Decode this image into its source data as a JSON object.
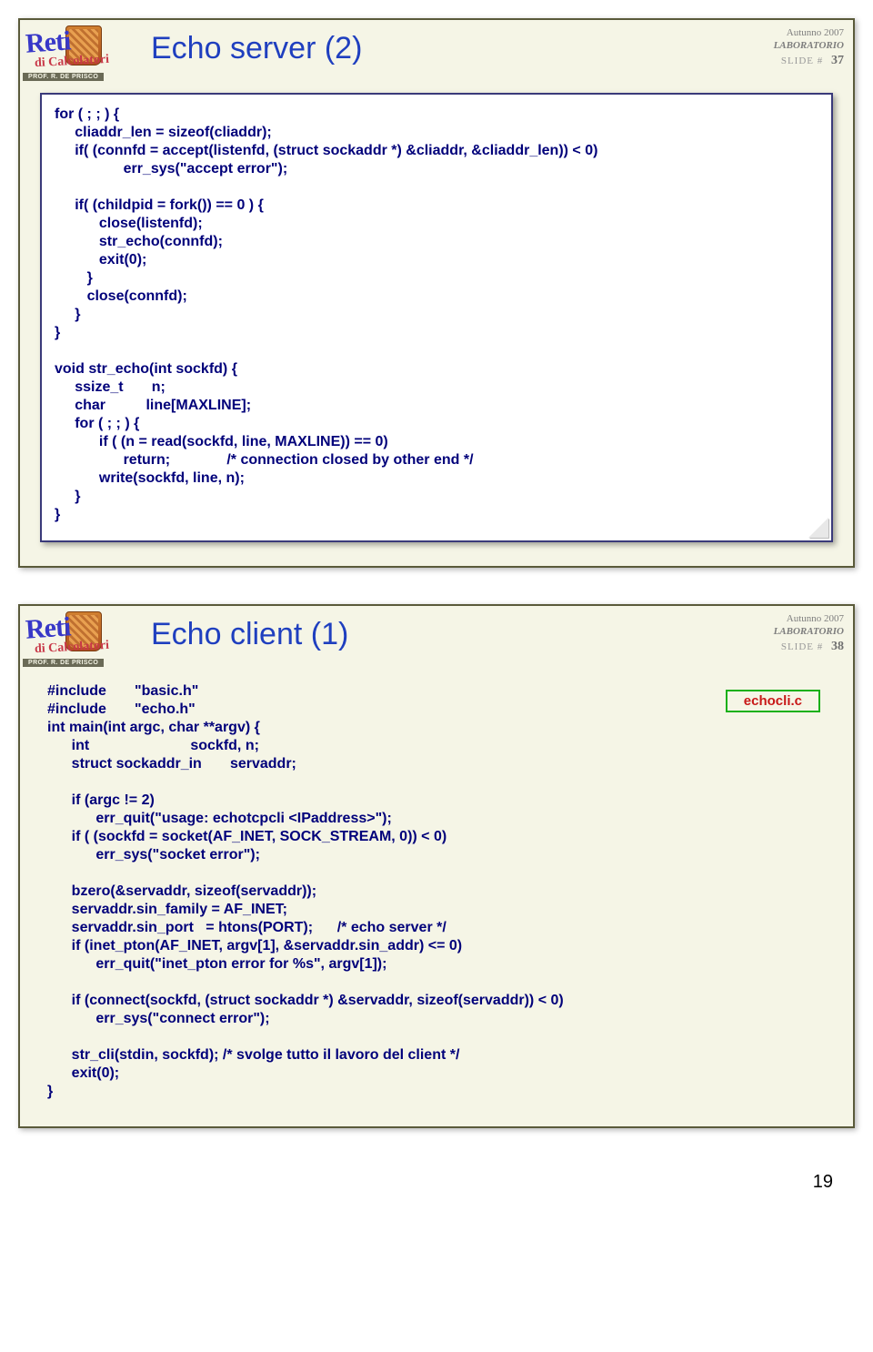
{
  "logo": {
    "main": "Reti",
    "sub": "di Calcolatori",
    "prof": "PROF. R. DE PRISCO"
  },
  "slide1": {
    "title": "Echo server (2)",
    "term": "Autunno 2007",
    "lab": "LABORATORIO",
    "slide_word": "SLIDE #",
    "slide_num": "37",
    "code": "for ( ; ; ) {\n     cliaddr_len = sizeof(cliaddr);\n     if( (connfd = accept(listenfd, (struct sockaddr *) &cliaddr, &cliaddr_len)) < 0)\n                 err_sys(\"accept error\");\n\n     if( (childpid = fork()) == 0 ) {\n           close(listenfd);\n           str_echo(connfd);\n           exit(0);\n        }\n        close(connfd);\n     }\n}\n\nvoid str_echo(int sockfd) {\n     ssize_t       n;\n     char          line[MAXLINE];\n     for ( ; ; ) {\n           if ( (n = read(sockfd, line, MAXLINE)) == 0)\n                 return;              /* connection closed by other end */\n           write(sockfd, line, n);\n     }\n}"
  },
  "slide2": {
    "title": "Echo client (1)",
    "term": "Autunno 2007",
    "lab": "LABORATORIO",
    "slide_word": "SLIDE #",
    "slide_num": "38",
    "filename": "echocli.c",
    "code": "#include       \"basic.h\"\n#include       \"echo.h\"\nint main(int argc, char **argv) {\n      int                         sockfd, n;\n      struct sockaddr_in       servaddr;\n\n      if (argc != 2)\n            err_quit(\"usage: echotcpcli <IPaddress>\");\n      if ( (sockfd = socket(AF_INET, SOCK_STREAM, 0)) < 0)\n            err_sys(\"socket error\");\n\n      bzero(&servaddr, sizeof(servaddr));\n      servaddr.sin_family = AF_INET;\n      servaddr.sin_port   = htons(PORT);      /* echo server */\n      if (inet_pton(AF_INET, argv[1], &servaddr.sin_addr) <= 0)\n            err_quit(\"inet_pton error for %s\", argv[1]);\n\n      if (connect(sockfd, (struct sockaddr *) &servaddr, sizeof(servaddr)) < 0)\n            err_sys(\"connect error\");\n\n      str_cli(stdin, sockfd); /* svolge tutto il lavoro del client */\n      exit(0);\n}"
  },
  "page_number": "19"
}
